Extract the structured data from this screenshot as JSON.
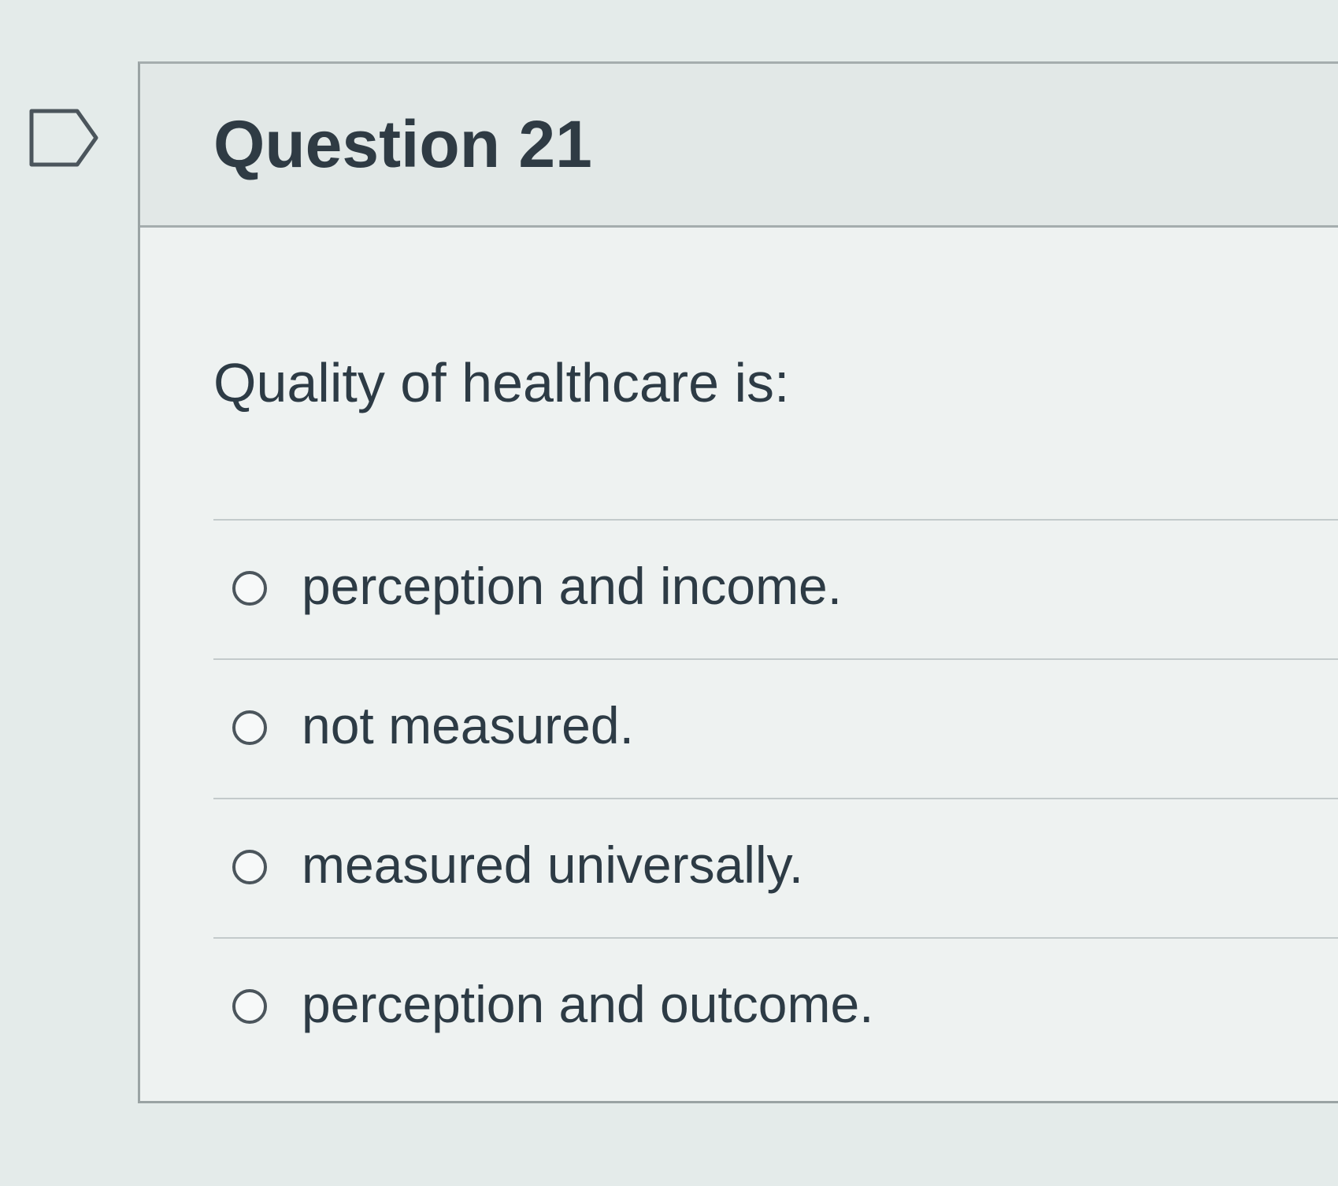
{
  "question": {
    "title": "Question 21",
    "text": "Quality of healthcare is:",
    "flag_icon": "flag-outline-icon",
    "answers": [
      {
        "label": "perception and income.",
        "selected": false
      },
      {
        "label": "not measured.",
        "selected": false
      },
      {
        "label": "measured universally.",
        "selected": false
      },
      {
        "label": "perception and outcome.",
        "selected": false
      }
    ]
  },
  "colors": {
    "background": "#e4ebea",
    "text": "#2d3b45",
    "border": "#a5adae"
  }
}
